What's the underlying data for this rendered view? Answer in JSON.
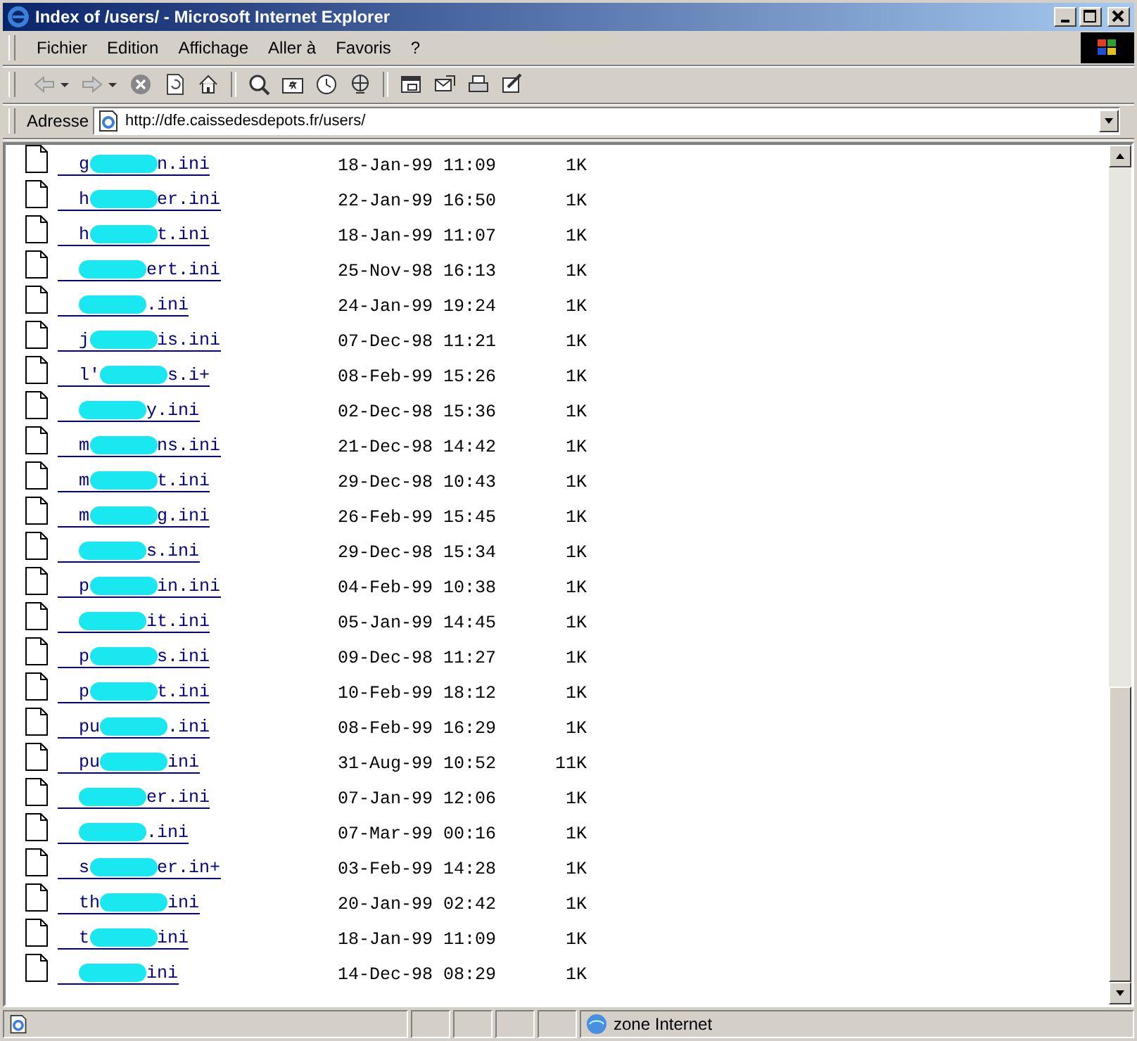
{
  "window": {
    "title": "Index of /users/ - Microsoft Internet Explorer"
  },
  "menu": [
    {
      "label": "Fichier"
    },
    {
      "label": "Edition"
    },
    {
      "label": "Affichage"
    },
    {
      "label": "Aller à"
    },
    {
      "label": "Favoris"
    },
    {
      "label": "?"
    }
  ],
  "address_bar": {
    "label": "Adresse",
    "value": "http://dfe.caissedesdepots.fr/users/"
  },
  "files": [
    {
      "name_start": "g",
      "name_end": "n.ini",
      "redacted": true,
      "modified": "18-Jan-99 11:09",
      "size": "1K"
    },
    {
      "name_start": "h",
      "name_end": "er.ini",
      "redacted": true,
      "modified": "22-Jan-99 16:50",
      "size": "1K"
    },
    {
      "name_start": "h",
      "name_end": "t.ini",
      "redacted": true,
      "modified": "18-Jan-99 11:07",
      "size": "1K"
    },
    {
      "name_end": "ert.ini",
      "redacted": true,
      "modified": "25-Nov-98 16:13",
      "size": "1K"
    },
    {
      "name_end": ".ini",
      "redacted": true,
      "modified": "24-Jan-99 19:24",
      "size": "1K"
    },
    {
      "name_start": "j",
      "name_end": "is.ini",
      "redacted": true,
      "modified": "07-Dec-98 11:21",
      "size": "1K"
    },
    {
      "name_start": "l'",
      "name_end": "s.i+",
      "redacted": true,
      "modified": "08-Feb-99 15:26",
      "size": "1K"
    },
    {
      "name_end": "y.ini",
      "redacted": true,
      "modified": "02-Dec-98 15:36",
      "size": "1K"
    },
    {
      "name_start": "m",
      "name_end": "ns.ini",
      "redacted": true,
      "modified": "21-Dec-98 14:42",
      "size": "1K"
    },
    {
      "name_start": "m",
      "name_end": "t.ini",
      "redacted": true,
      "modified": "29-Dec-98 10:43",
      "size": "1K"
    },
    {
      "name_start": "m",
      "name_end": "g.ini",
      "redacted": true,
      "modified": "26-Feb-99 15:45",
      "size": "1K"
    },
    {
      "name_end": "s.ini",
      "redacted": true,
      "modified": "29-Dec-98 15:34",
      "size": "1K"
    },
    {
      "name_start": "p",
      "name_end": "in.ini",
      "redacted": true,
      "modified": "04-Feb-99 10:38",
      "size": "1K"
    },
    {
      "name_end": "it.ini",
      "redacted": true,
      "modified": "05-Jan-99 14:45",
      "size": "1K"
    },
    {
      "name_start": "p",
      "name_end": "s.ini",
      "redacted": true,
      "modified": "09-Dec-98 11:27",
      "size": "1K"
    },
    {
      "name_start": "p",
      "name_end": "t.ini",
      "redacted": true,
      "modified": "10-Feb-99 18:12",
      "size": "1K"
    },
    {
      "name_start": "pu",
      "name_end": ".ini",
      "redacted": true,
      "modified": "08-Feb-99 16:29",
      "size": "1K"
    },
    {
      "name_start": "pu",
      "name_end": "ini",
      "redacted": true,
      "modified": "31-Aug-99 10:52",
      "size": "11K"
    },
    {
      "name_end": "er.ini",
      "redacted": true,
      "modified": "07-Jan-99 12:06",
      "size": "1K"
    },
    {
      "name_end": ".ini",
      "redacted": true,
      "modified": "07-Mar-99 00:16",
      "size": "1K"
    },
    {
      "name_start": "s",
      "name_end": "er.in+",
      "redacted": true,
      "modified": "03-Feb-99 14:28",
      "size": "1K"
    },
    {
      "name_start": "th",
      "name_end": "ini",
      "redacted": true,
      "modified": "20-Jan-99 02:42",
      "size": "1K"
    },
    {
      "name_start": "t",
      "name_end": "ini",
      "redacted": true,
      "modified": "18-Jan-99 11:09",
      "size": "1K"
    },
    {
      "name_end": "ini",
      "redacted": true,
      "modified": "14-Dec-98 08:29",
      "size": "1K"
    }
  ],
  "status_bar": {
    "zone": "zone Internet"
  }
}
